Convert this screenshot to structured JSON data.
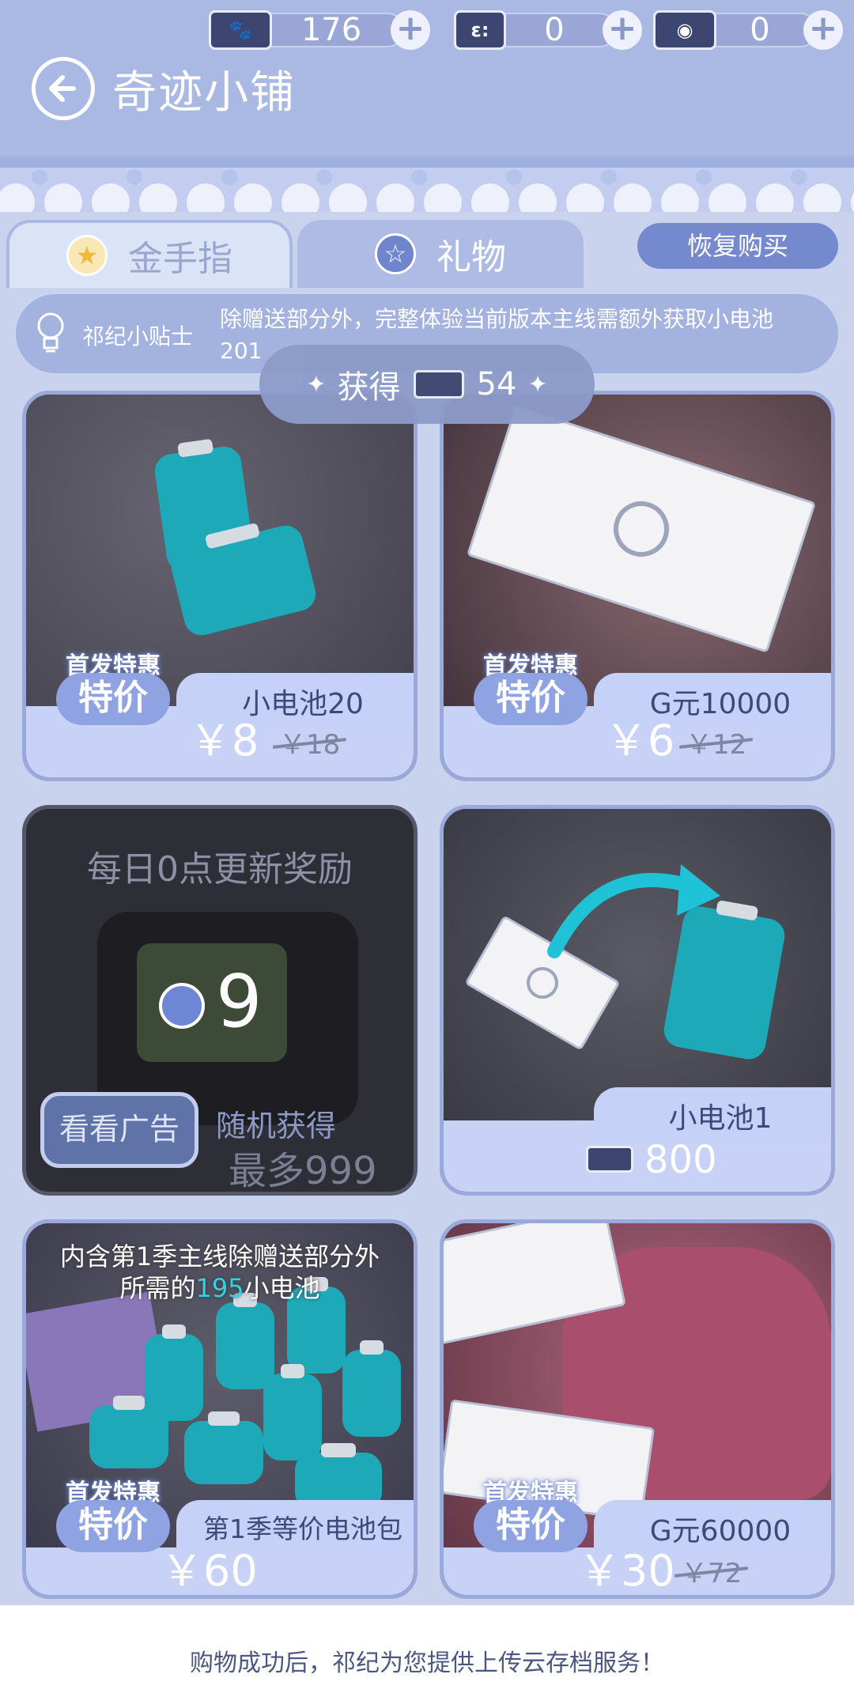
{
  "currencies": [
    {
      "icon": "paw-bill-icon",
      "value": "176",
      "glyph": "🐾"
    },
    {
      "icon": "battery-ticket-icon",
      "value": "0",
      "glyph": "ε:"
    },
    {
      "icon": "cash-icon",
      "value": "0",
      "glyph": "◉"
    }
  ],
  "header": {
    "title": "奇迹小铺"
  },
  "tabs": [
    {
      "label": "金手指"
    },
    {
      "label": "礼物"
    }
  ],
  "restore_button": "恢复购买",
  "tips": {
    "label": "祁纪小贴士",
    "text": "除赠送部分外，完整体验当前版本主线需额外获取小电池201"
  },
  "gain_popup": {
    "label": "获得",
    "value": "54"
  },
  "products": [
    {
      "badge_top": "首发特惠",
      "badge_main": "特价",
      "name": "小电池20",
      "price": "￥8",
      "old_price": "￥18"
    },
    {
      "badge_top": "首发特惠",
      "badge_main": "特价",
      "name": "G元10000",
      "price": "￥6",
      "old_price": "￥12"
    },
    {
      "ad_title": "每日0点更新奖励",
      "countdown": "9",
      "watch_label": "看看广告",
      "random_label": "随机获得",
      "max_label": "最多999"
    },
    {
      "name": "小电池1",
      "price": "800"
    },
    {
      "caption_line1": "内含第1季主线除赠送部分外",
      "caption_line2_pre": "所需的",
      "caption_highlight": "195",
      "caption_line2_post": "小电池",
      "badge_top": "首发特惠",
      "badge_main": "特价",
      "name": "第1季等价电池包",
      "price": "￥60"
    },
    {
      "badge_top": "首发特惠",
      "badge_main": "特价",
      "name": "G元60000",
      "price": "￥30",
      "old_price": "￥72"
    }
  ],
  "footer": {
    "text": "购物成功后，祁纪为您提供上传云存档服务！"
  },
  "colors": {
    "accent": "#7589ce",
    "header": "#aab8e4",
    "teal": "#1ea9b8"
  }
}
